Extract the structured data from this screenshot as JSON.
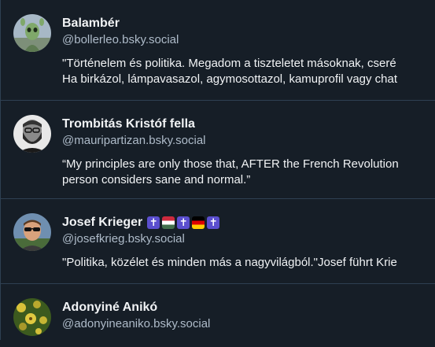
{
  "users": [
    {
      "name": "Balambér",
      "handle": "@bollerleo.bsky.social",
      "bio_line1": "\"Történelem és politika. Megadom a tiszteletet másoknak, cseré",
      "bio_line2": "Ha birkázol, lámpavasazol, agymosottazol, kamuprofil vagy chat",
      "avatar_icon": "alien-avatar-icon"
    },
    {
      "name": "Trombitás Kristóf fella",
      "handle": "@mauripartizan.bsky.social",
      "bio_line1": "“My principles are only those that, AFTER the French Revolution",
      "bio_line2": "person considers sane and normal.”",
      "avatar_icon": "bearded-man-avatar-icon"
    },
    {
      "name": "Josef Krieger",
      "handle": "@josefkrieg.bsky.social",
      "bio_line1": "\"Politika, közélet és minden más a nagyvilágból.\"Josef führt Krie",
      "badges": [
        "cross-icon",
        "hungary-flag-icon",
        "cross-icon",
        "germany-flag-icon",
        "cross-icon"
      ],
      "badge_cross_char": "✝",
      "avatar_icon": "sunglasses-man-avatar-icon"
    },
    {
      "name": "Adonyiné Anikó",
      "handle": "@adonyineaniko.bsky.social",
      "avatar_icon": "flowers-avatar-icon"
    }
  ],
  "colors": {
    "background": "#161e27",
    "divider": "#2e4052",
    "text_primary": "#f1f3f5",
    "text_secondary": "#aebbc9",
    "badge_purple": "#5b4fcf"
  }
}
